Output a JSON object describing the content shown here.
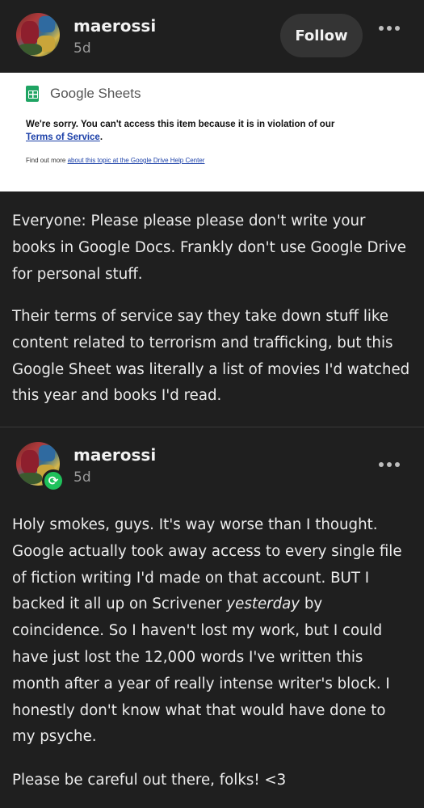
{
  "post": {
    "username": "maerossi",
    "time": "5d",
    "follow_label": "Follow",
    "embedded_notice": {
      "app_name": "Google Sheets",
      "message": "We're sorry. You can't access this item because it is in violation of our",
      "link": "Terms of Service",
      "link_suffix": ".",
      "footer_prefix": "Find out more",
      "footer_link": "about this topic at the Google Drive Help Center"
    },
    "paragraphs": [
      "Everyone: Please please please don't write your books in Google Docs. Frankly don't use Google Drive for personal stuff.",
      "Their terms of service say they take down stuff like content related to terrorism and trafficking, but this Google Sheet was literally a list of movies I'd watched this year and books I'd read."
    ]
  },
  "reblog": {
    "username": "maerossi",
    "time": "5d",
    "paragraph_before_em": "Holy smokes, guys. It's way worse than I thought. Google actually took away access to every single file of fiction writing I'd made on that account. BUT I backed it all up on Scrivener ",
    "em_text": "yesterday",
    "paragraph_after_em": " by coincidence. So I haven't lost my work, but I could have just lost the 12,000 words I've written this month after a year of really intense writer's block. I honestly don't know what that would have done to my psyche.",
    "closing": "Please be careful out there, folks! <3"
  },
  "colors": {
    "background": "#1f1f1f",
    "text": "#ececec",
    "muted": "#9a9a9a",
    "follow_bg": "#343434",
    "reblog_badge": "#1fc15b",
    "link": "#1a3fa8"
  },
  "icons": [
    "more-options-icon",
    "google-sheets-icon",
    "reblog-icon"
  ]
}
